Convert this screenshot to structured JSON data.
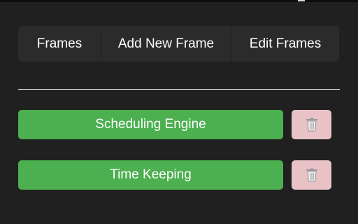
{
  "nav": {
    "frames_label": "Frames",
    "add_label": "Add New Frame",
    "edit_label": "Edit Frames"
  },
  "frames": [
    {
      "label": "Scheduling Engine",
      "delete_icon": "trash-icon"
    },
    {
      "label": "Time Keeping",
      "delete_icon": "trash-icon"
    }
  ],
  "colors": {
    "background": "#202020",
    "nav_button": "#2b2b2b",
    "frame_button": "#4caf50",
    "delete_button": "#e8c2c6"
  }
}
